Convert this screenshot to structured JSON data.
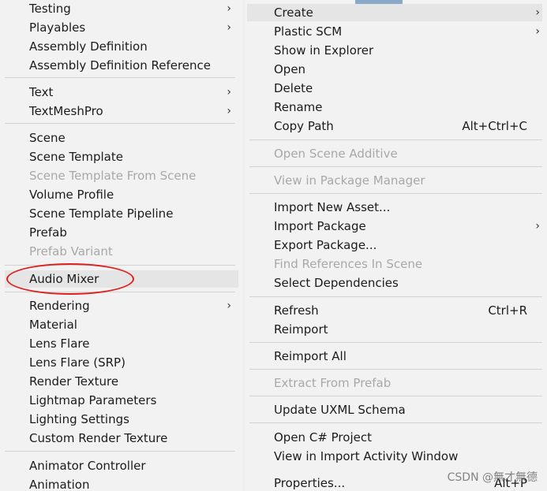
{
  "left_menu": {
    "items": [
      {
        "label": "Testing",
        "arrow": "›"
      },
      {
        "label": "Playables",
        "arrow": "›"
      },
      {
        "label": "Assembly Definition"
      },
      {
        "label": "Assembly Definition Reference"
      },
      {
        "label": "Text",
        "arrow": "›"
      },
      {
        "label": "TextMeshPro",
        "arrow": "›"
      },
      {
        "label": "Scene"
      },
      {
        "label": "Scene Template"
      },
      {
        "label": "Scene Template From Scene"
      },
      {
        "label": "Volume Profile"
      },
      {
        "label": "Scene Template Pipeline"
      },
      {
        "label": "Prefab"
      },
      {
        "label": "Prefab Variant"
      },
      {
        "label": "Audio Mixer"
      },
      {
        "label": "Rendering",
        "arrow": "›"
      },
      {
        "label": "Material"
      },
      {
        "label": "Lens Flare"
      },
      {
        "label": "Lens Flare (SRP)"
      },
      {
        "label": "Render Texture"
      },
      {
        "label": "Lightmap Parameters"
      },
      {
        "label": "Lighting Settings"
      },
      {
        "label": "Custom Render Texture"
      },
      {
        "label": "Animator Controller"
      },
      {
        "label": "Animation"
      }
    ]
  },
  "right_menu": {
    "items": [
      {
        "label": "Create",
        "arrow": "›"
      },
      {
        "label": "Plastic SCM",
        "arrow": "›"
      },
      {
        "label": "Show in Explorer"
      },
      {
        "label": "Open"
      },
      {
        "label": "Delete"
      },
      {
        "label": "Rename"
      },
      {
        "label": "Copy Path",
        "shortcut": "Alt+Ctrl+C"
      },
      {
        "label": "Open Scene Additive"
      },
      {
        "label": "View in Package Manager"
      },
      {
        "label": "Import New Asset..."
      },
      {
        "label": "Import Package",
        "arrow": "›"
      },
      {
        "label": "Export Package..."
      },
      {
        "label": "Find References In Scene"
      },
      {
        "label": "Select Dependencies"
      },
      {
        "label": "Refresh",
        "shortcut": "Ctrl+R"
      },
      {
        "label": "Reimport"
      },
      {
        "label": "Reimport All"
      },
      {
        "label": "Extract From Prefab"
      },
      {
        "label": "Update UXML Schema"
      },
      {
        "label": "Open C# Project"
      },
      {
        "label": "View in Import Activity Window"
      },
      {
        "label": "Properties...",
        "shortcut": "Alt+P"
      }
    ]
  },
  "watermark": "CSDN @無才無德",
  "colors": {
    "annotation_circle": "#e01e1e",
    "disabled_text": "#a8a8a8",
    "menu_background": "#f2f2f2"
  }
}
